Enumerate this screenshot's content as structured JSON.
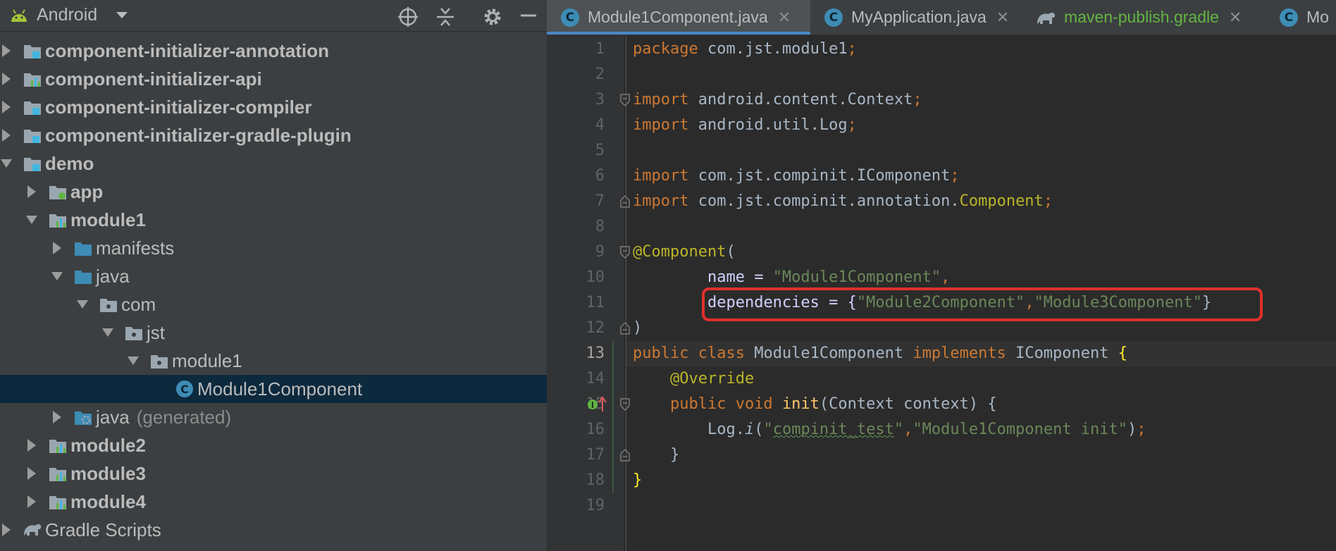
{
  "project_panel": {
    "view_selector": "Android",
    "toolbar_icons": [
      "locate-icon",
      "collapse-all-icon",
      "settings-gear-icon",
      "hide-panel-icon"
    ],
    "tree": [
      {
        "label": "component-initializer-annotation",
        "icon": "module-folder-icon",
        "expanded": false,
        "bold": true
      },
      {
        "label": "component-initializer-api",
        "icon": "library-module-icon",
        "expanded": false,
        "bold": true
      },
      {
        "label": "component-initializer-compiler",
        "icon": "module-folder-icon",
        "expanded": false,
        "bold": true
      },
      {
        "label": "component-initializer-gradle-plugin",
        "icon": "module-folder-icon",
        "expanded": false,
        "bold": true
      },
      {
        "label": "demo",
        "icon": "module-folder-icon",
        "expanded": true,
        "bold": true
      },
      {
        "label": "app",
        "icon": "app-module-icon",
        "expanded": false,
        "bold": true
      },
      {
        "label": "module1",
        "icon": "library-module-icon",
        "expanded": true,
        "bold": true
      },
      {
        "label": "manifests",
        "icon": "folder-icon",
        "expanded": false,
        "bold": false
      },
      {
        "label": "java",
        "icon": "folder-icon",
        "expanded": true,
        "bold": false
      },
      {
        "label": "com",
        "icon": "package-icon",
        "expanded": true,
        "bold": false
      },
      {
        "label": "jst",
        "icon": "package-icon",
        "expanded": true,
        "bold": false
      },
      {
        "label": "module1",
        "icon": "package-icon",
        "expanded": true,
        "bold": false
      },
      {
        "label": "Module1Component",
        "icon": "java-class-icon",
        "expanded": null,
        "bold": false,
        "selected": true
      },
      {
        "label": "java",
        "suffix": "(generated)",
        "icon": "generated-folder-icon",
        "expanded": false,
        "bold": false
      },
      {
        "label": "module2",
        "icon": "library-module-icon",
        "expanded": false,
        "bold": true
      },
      {
        "label": "module3",
        "icon": "library-module-icon",
        "expanded": false,
        "bold": true
      },
      {
        "label": "module4",
        "icon": "library-module-icon",
        "expanded": false,
        "bold": true
      },
      {
        "label": "Gradle Scripts",
        "icon": "gradle-elephant-icon",
        "expanded": false,
        "bold": false
      }
    ]
  },
  "editor": {
    "tabs": [
      {
        "label": "Module1Component.java",
        "icon": "java-class-icon",
        "active": true
      },
      {
        "label": "MyApplication.java",
        "icon": "java-class-icon",
        "active": false
      },
      {
        "label": "maven-publish.gradle",
        "icon": "gradle-elephant-icon",
        "active": false
      },
      {
        "label": "Mo",
        "icon": "java-class-icon",
        "active": false
      }
    ],
    "current_line": 13,
    "line_numbers": [
      "1",
      "2",
      "3",
      "4",
      "5",
      "6",
      "7",
      "8",
      "9",
      "10",
      "11",
      "12",
      "13",
      "14",
      "15",
      "16",
      "17",
      "18",
      "19"
    ],
    "code": {
      "l1": {
        "kw": "package",
        "rest": " com.jst.module1",
        "semi": ";"
      },
      "l3": {
        "kw": "import",
        "rest": " android.content.Context",
        "semi": ";"
      },
      "l4": {
        "kw": "import",
        "rest": " android.util.Log",
        "semi": ";"
      },
      "l6": {
        "kw": "import",
        "rest": " com.jst.compinit.IComponent",
        "semi": ";"
      },
      "l7": {
        "kw": "import",
        "rest": " com.jst.compinit.annotation.",
        "ann": "Component",
        "semi": ";"
      },
      "l9": {
        "ann": "@Component",
        "rest": "("
      },
      "l10": {
        "indent": "        ",
        "name": "name = ",
        "str": "\"Module1Component\"",
        "comma": ","
      },
      "l11": {
        "indent": "        ",
        "name": "dependencies = {",
        "str1": "\"Module2Component\"",
        "comma": ",",
        "str2": "\"Module3Component\"",
        "close": "}"
      },
      "l12": {
        "text": ")"
      },
      "l13": {
        "kw1": "public class",
        "name": " Module1Component ",
        "kw2": "implements",
        "iface": " IComponent ",
        "brace": "{"
      },
      "l14": {
        "indent": "    ",
        "ann": "@Override"
      },
      "l15": {
        "indent": "    ",
        "kw": "public void",
        "sp": " ",
        "fn": "init",
        "rest": "(Context context) {"
      },
      "l16": {
        "indent": "        ",
        "obj": "Log.",
        "method": "i",
        "open": "(",
        "q1": "\"",
        "typo": "compinit_test",
        "q2": "\"",
        "comma": ",",
        "str": "\"Module1Component init\"",
        "close": ")",
        "semi": ";"
      },
      "l17": {
        "indent": "    ",
        "text": "}"
      },
      "l18": {
        "brace": "}"
      }
    }
  }
}
